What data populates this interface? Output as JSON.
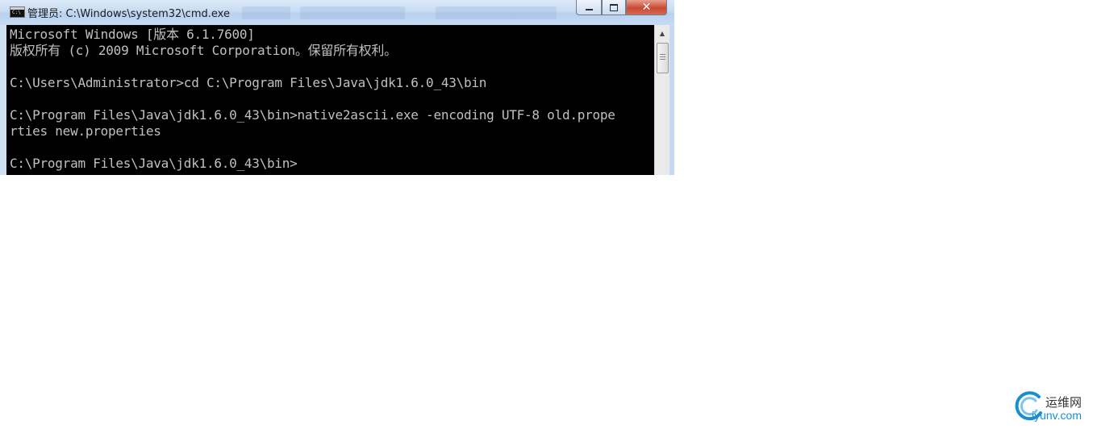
{
  "window": {
    "title": "管理员: C:\\Windows\\system32\\cmd.exe",
    "controls": {
      "minimize": "",
      "maximize": "",
      "close": "✕"
    }
  },
  "console": {
    "lines": [
      "Microsoft Windows [版本 6.1.7600]",
      "版权所有 (c) 2009 Microsoft Corporation。保留所有权利。",
      "",
      "C:\\Users\\Administrator>cd C:\\Program Files\\Java\\jdk1.6.0_43\\bin",
      "",
      "C:\\Program Files\\Java\\jdk1.6.0_43\\bin>native2ascii.exe -encoding UTF-8 old.prope",
      "rties new.properties",
      "",
      "C:\\Program Files\\Java\\jdk1.6.0_43\\bin>"
    ]
  },
  "watermark": {
    "name": "运维网",
    "url": "iyunv.com"
  }
}
